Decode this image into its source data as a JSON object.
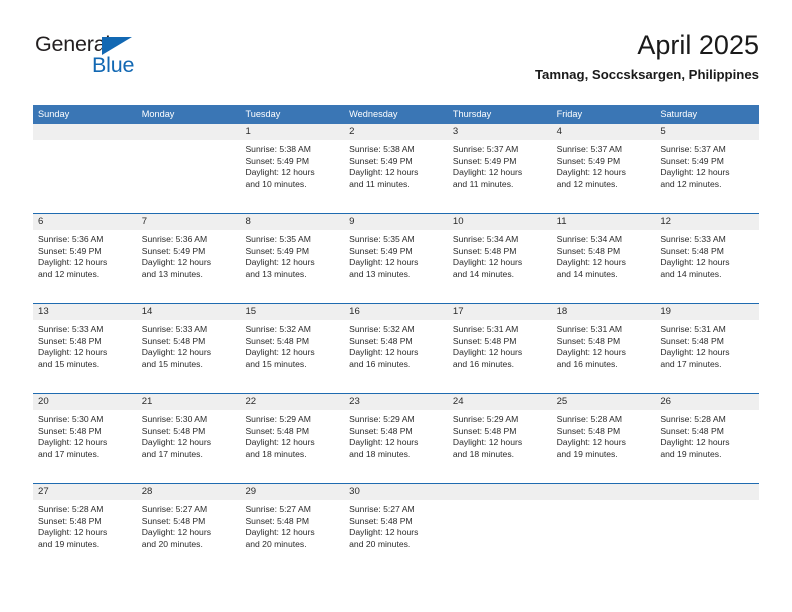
{
  "brand": {
    "name_top": "General",
    "name_bottom": "Blue",
    "triangle_icon": "triangle-icon",
    "color_dark": "#231f20",
    "color_blue": "#1268b3"
  },
  "header": {
    "title": "April 2025",
    "subtitle": "Tamnag, Soccsksargen, Philippines"
  },
  "theme": {
    "header_blue": "#3a76b5",
    "row_divider_blue": "#1f6bb0",
    "daynum_band": "#efefef",
    "text": "#2b2b2b"
  },
  "calendar": {
    "weekdays": [
      "Sunday",
      "Monday",
      "Tuesday",
      "Wednesday",
      "Thursday",
      "Friday",
      "Saturday"
    ],
    "weeks": [
      [
        {
          "day": "",
          "lines": []
        },
        {
          "day": "",
          "lines": []
        },
        {
          "day": "1",
          "lines": [
            "Sunrise: 5:38 AM",
            "Sunset: 5:49 PM",
            "Daylight: 12 hours",
            "and 10 minutes."
          ]
        },
        {
          "day": "2",
          "lines": [
            "Sunrise: 5:38 AM",
            "Sunset: 5:49 PM",
            "Daylight: 12 hours",
            "and 11 minutes."
          ]
        },
        {
          "day": "3",
          "lines": [
            "Sunrise: 5:37 AM",
            "Sunset: 5:49 PM",
            "Daylight: 12 hours",
            "and 11 minutes."
          ]
        },
        {
          "day": "4",
          "lines": [
            "Sunrise: 5:37 AM",
            "Sunset: 5:49 PM",
            "Daylight: 12 hours",
            "and 12 minutes."
          ]
        },
        {
          "day": "5",
          "lines": [
            "Sunrise: 5:37 AM",
            "Sunset: 5:49 PM",
            "Daylight: 12 hours",
            "and 12 minutes."
          ]
        }
      ],
      [
        {
          "day": "6",
          "lines": [
            "Sunrise: 5:36 AM",
            "Sunset: 5:49 PM",
            "Daylight: 12 hours",
            "and 12 minutes."
          ]
        },
        {
          "day": "7",
          "lines": [
            "Sunrise: 5:36 AM",
            "Sunset: 5:49 PM",
            "Daylight: 12 hours",
            "and 13 minutes."
          ]
        },
        {
          "day": "8",
          "lines": [
            "Sunrise: 5:35 AM",
            "Sunset: 5:49 PM",
            "Daylight: 12 hours",
            "and 13 minutes."
          ]
        },
        {
          "day": "9",
          "lines": [
            "Sunrise: 5:35 AM",
            "Sunset: 5:49 PM",
            "Daylight: 12 hours",
            "and 13 minutes."
          ]
        },
        {
          "day": "10",
          "lines": [
            "Sunrise: 5:34 AM",
            "Sunset: 5:48 PM",
            "Daylight: 12 hours",
            "and 14 minutes."
          ]
        },
        {
          "day": "11",
          "lines": [
            "Sunrise: 5:34 AM",
            "Sunset: 5:48 PM",
            "Daylight: 12 hours",
            "and 14 minutes."
          ]
        },
        {
          "day": "12",
          "lines": [
            "Sunrise: 5:33 AM",
            "Sunset: 5:48 PM",
            "Daylight: 12 hours",
            "and 14 minutes."
          ]
        }
      ],
      [
        {
          "day": "13",
          "lines": [
            "Sunrise: 5:33 AM",
            "Sunset: 5:48 PM",
            "Daylight: 12 hours",
            "and 15 minutes."
          ]
        },
        {
          "day": "14",
          "lines": [
            "Sunrise: 5:33 AM",
            "Sunset: 5:48 PM",
            "Daylight: 12 hours",
            "and 15 minutes."
          ]
        },
        {
          "day": "15",
          "lines": [
            "Sunrise: 5:32 AM",
            "Sunset: 5:48 PM",
            "Daylight: 12 hours",
            "and 15 minutes."
          ]
        },
        {
          "day": "16",
          "lines": [
            "Sunrise: 5:32 AM",
            "Sunset: 5:48 PM",
            "Daylight: 12 hours",
            "and 16 minutes."
          ]
        },
        {
          "day": "17",
          "lines": [
            "Sunrise: 5:31 AM",
            "Sunset: 5:48 PM",
            "Daylight: 12 hours",
            "and 16 minutes."
          ]
        },
        {
          "day": "18",
          "lines": [
            "Sunrise: 5:31 AM",
            "Sunset: 5:48 PM",
            "Daylight: 12 hours",
            "and 16 minutes."
          ]
        },
        {
          "day": "19",
          "lines": [
            "Sunrise: 5:31 AM",
            "Sunset: 5:48 PM",
            "Daylight: 12 hours",
            "and 17 minutes."
          ]
        }
      ],
      [
        {
          "day": "20",
          "lines": [
            "Sunrise: 5:30 AM",
            "Sunset: 5:48 PM",
            "Daylight: 12 hours",
            "and 17 minutes."
          ]
        },
        {
          "day": "21",
          "lines": [
            "Sunrise: 5:30 AM",
            "Sunset: 5:48 PM",
            "Daylight: 12 hours",
            "and 17 minutes."
          ]
        },
        {
          "day": "22",
          "lines": [
            "Sunrise: 5:29 AM",
            "Sunset: 5:48 PM",
            "Daylight: 12 hours",
            "and 18 minutes."
          ]
        },
        {
          "day": "23",
          "lines": [
            "Sunrise: 5:29 AM",
            "Sunset: 5:48 PM",
            "Daylight: 12 hours",
            "and 18 minutes."
          ]
        },
        {
          "day": "24",
          "lines": [
            "Sunrise: 5:29 AM",
            "Sunset: 5:48 PM",
            "Daylight: 12 hours",
            "and 18 minutes."
          ]
        },
        {
          "day": "25",
          "lines": [
            "Sunrise: 5:28 AM",
            "Sunset: 5:48 PM",
            "Daylight: 12 hours",
            "and 19 minutes."
          ]
        },
        {
          "day": "26",
          "lines": [
            "Sunrise: 5:28 AM",
            "Sunset: 5:48 PM",
            "Daylight: 12 hours",
            "and 19 minutes."
          ]
        }
      ],
      [
        {
          "day": "27",
          "lines": [
            "Sunrise: 5:28 AM",
            "Sunset: 5:48 PM",
            "Daylight: 12 hours",
            "and 19 minutes."
          ]
        },
        {
          "day": "28",
          "lines": [
            "Sunrise: 5:27 AM",
            "Sunset: 5:48 PM",
            "Daylight: 12 hours",
            "and 20 minutes."
          ]
        },
        {
          "day": "29",
          "lines": [
            "Sunrise: 5:27 AM",
            "Sunset: 5:48 PM",
            "Daylight: 12 hours",
            "and 20 minutes."
          ]
        },
        {
          "day": "30",
          "lines": [
            "Sunrise: 5:27 AM",
            "Sunset: 5:48 PM",
            "Daylight: 12 hours",
            "and 20 minutes."
          ]
        },
        {
          "day": "",
          "lines": []
        },
        {
          "day": "",
          "lines": []
        },
        {
          "day": "",
          "lines": []
        }
      ]
    ]
  }
}
